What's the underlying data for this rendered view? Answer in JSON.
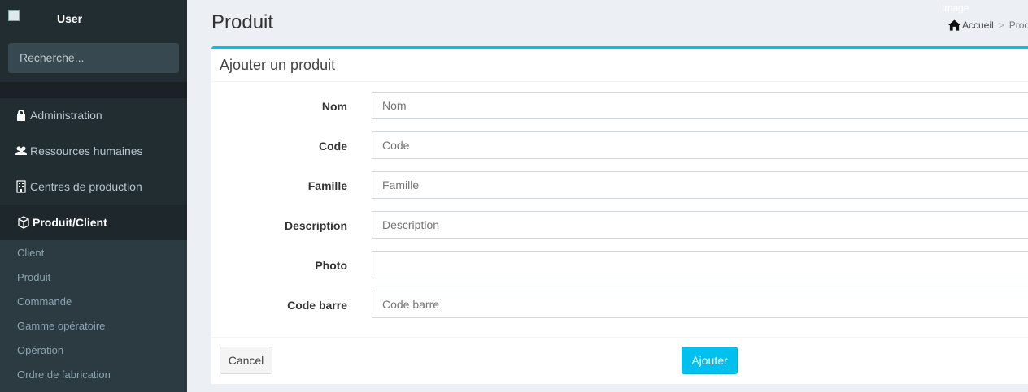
{
  "sidebar": {
    "user_name": "User",
    "search_placeholder": "Recherche...",
    "items": [
      {
        "label": "Administration",
        "icon": "lock-icon"
      },
      {
        "label": "Ressources humaines",
        "icon": "users-icon"
      },
      {
        "label": "Centres de production",
        "icon": "building-icon"
      },
      {
        "label": "Produit/Client",
        "icon": "cube-icon",
        "active": true
      }
    ],
    "submenu": [
      "Client",
      "Produit",
      "Commande",
      "Gamme opératoire",
      "Opération",
      "Ordre de fabrication"
    ]
  },
  "header": {
    "title": "Produit",
    "image_alt": "Image",
    "breadcrumb": {
      "home": "Accueil",
      "current": "Prod"
    }
  },
  "form": {
    "title": "Ajouter un produit",
    "fields": [
      {
        "label": "Nom",
        "placeholder": "Nom"
      },
      {
        "label": "Code",
        "placeholder": "Code"
      },
      {
        "label": "Famille",
        "placeholder": "Famille"
      },
      {
        "label": "Description",
        "placeholder": "Description"
      },
      {
        "label": "Photo",
        "placeholder": ""
      },
      {
        "label": "Code barre",
        "placeholder": "Code barre"
      }
    ],
    "cancel_label": "Cancel",
    "submit_label": "Ajouter"
  },
  "colors": {
    "accent": "#00c0ef",
    "sidebar": "#222d32",
    "submenu": "#2c3b41"
  }
}
